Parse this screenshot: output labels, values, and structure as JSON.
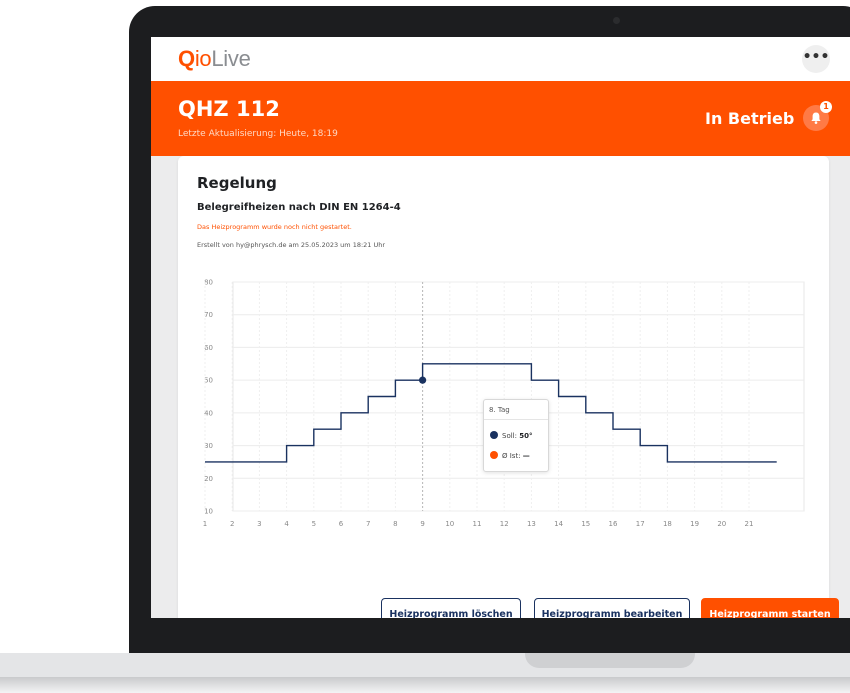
{
  "app": {
    "logo": {
      "q": "Q",
      "io": "io",
      "live": "Live"
    },
    "more_label": "•••"
  },
  "header": {
    "device_name": "QHZ 112",
    "last_update": "Letzte Aktualisierung: Heute, 18:19",
    "status": "In Betrieb",
    "notification_count": "1"
  },
  "card": {
    "title": "Regelung",
    "subtitle": "Belegreifheizen nach DIN EN 1264-4",
    "warning": "Das Heizprogramm wurde noch nicht gestartet.",
    "created": "Erstellt von hy@phrysch.de am 25.05.2023 um 18:21 Uhr"
  },
  "tooltip": {
    "day": "8. Tag",
    "soll_label": "Soll:",
    "soll_value": "50°",
    "ist_label": "Ø Ist:",
    "ist_value": "—"
  },
  "buttons": {
    "delete": "Heizprogramm löschen",
    "edit": "Heizprogramm bearbeiten",
    "start": "Heizprogramm starten"
  },
  "colors": {
    "accent": "#ff5000",
    "navy": "#1a3260"
  },
  "chart_data": {
    "type": "line",
    "step": true,
    "x_ticks": [
      1,
      2,
      3,
      4,
      5,
      6,
      7,
      8,
      9,
      10,
      11,
      12,
      13,
      14,
      15,
      16,
      17,
      18,
      19,
      20,
      21
    ],
    "y_ticks": [
      10,
      20,
      30,
      40,
      50,
      60,
      70,
      80
    ],
    "ylim": [
      10,
      80
    ],
    "xlim": [
      1,
      22
    ],
    "grid": true,
    "series": [
      {
        "label": "Soll",
        "color": "#1a3260",
        "x": [
          1,
          4,
          5,
          6,
          7,
          8,
          9,
          13,
          14,
          15,
          16,
          17,
          18,
          22
        ],
        "y": [
          25,
          30,
          35,
          40,
          45,
          50,
          55,
          50,
          45,
          40,
          35,
          30,
          25,
          25
        ]
      }
    ],
    "hover": {
      "x": 8,
      "y": 50
    }
  }
}
